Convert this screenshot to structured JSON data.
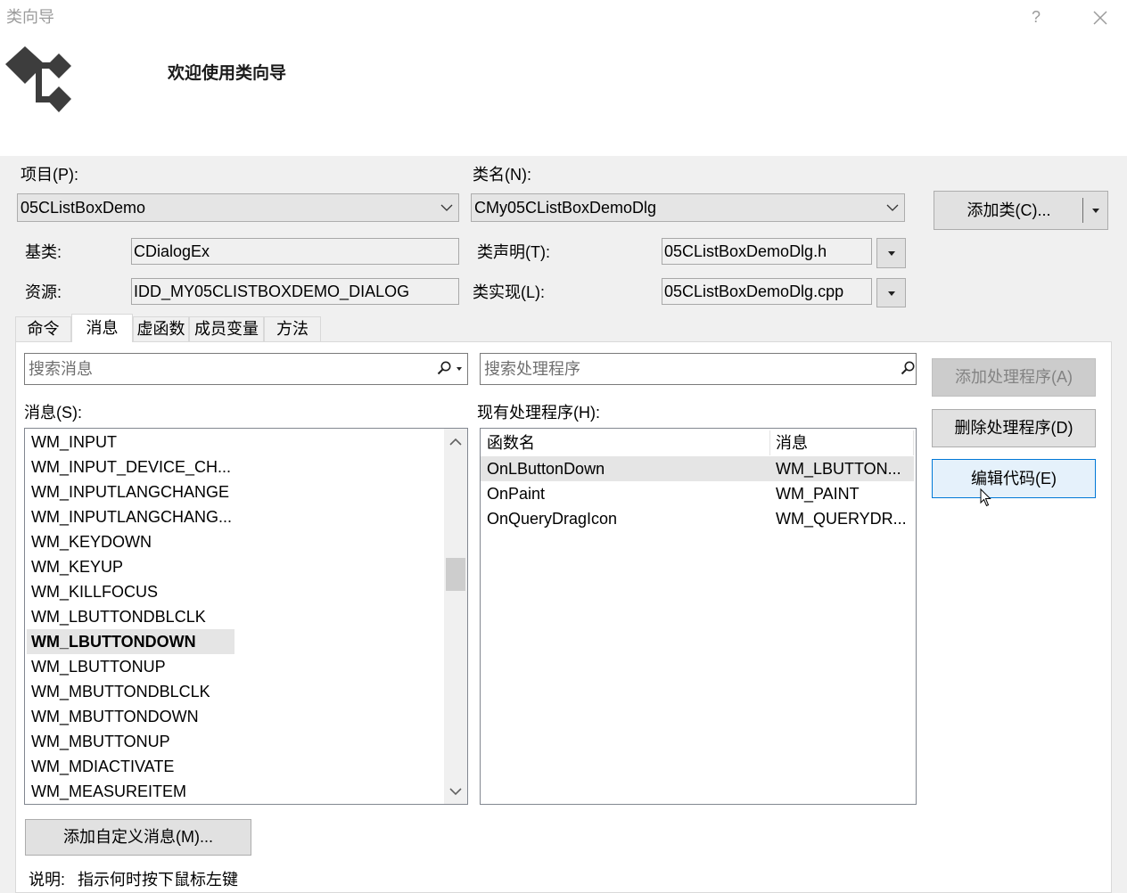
{
  "window": {
    "title": "类向导",
    "help_label": "?"
  },
  "header": {
    "welcome": "欢迎使用类向导"
  },
  "project": {
    "label": "项目(P):",
    "value": "05CListBoxDemo"
  },
  "class_name": {
    "label": "类名(N):",
    "value": "CMy05CListBoxDemoDlg"
  },
  "add_class_button": {
    "label": "添加类(C)..."
  },
  "base_class": {
    "label": "基类:",
    "value": "CDialogEx"
  },
  "class_declaration": {
    "label": "类声明(T):",
    "value": "05CListBoxDemoDlg.h"
  },
  "resource": {
    "label": "资源:",
    "value": "IDD_MY05CLISTBOXDEMO_DIALOG"
  },
  "class_implementation": {
    "label": "类实现(L):",
    "value": "05CListBoxDemoDlg.cpp"
  },
  "tabs": [
    {
      "label": "命令",
      "selected": false
    },
    {
      "label": "消息",
      "selected": true
    },
    {
      "label": "虚函数",
      "selected": false
    },
    {
      "label": "成员变量",
      "selected": false
    },
    {
      "label": "方法",
      "selected": false
    }
  ],
  "messages": {
    "search_placeholder": "搜索消息",
    "label": "消息(S):",
    "items": [
      "WM_INPUT",
      "WM_INPUT_DEVICE_CH...",
      "WM_INPUTLANGCHANGE",
      "WM_INPUTLANGCHANG...",
      "WM_KEYDOWN",
      "WM_KEYUP",
      "WM_KILLFOCUS",
      "WM_LBUTTONDBLCLK",
      "WM_LBUTTONDOWN",
      "WM_LBUTTONUP",
      "WM_MBUTTONDBLCLK",
      "WM_MBUTTONDOWN",
      "WM_MBUTTONUP",
      "WM_MDIACTIVATE",
      "WM_MEASUREITEM"
    ],
    "selected_index": 8
  },
  "handlers": {
    "search_placeholder": "搜索处理程序",
    "label": "现有处理程序(H):",
    "columns": {
      "function": "函数名",
      "message": "消息"
    },
    "rows": [
      {
        "function": "OnLButtonDown",
        "message": "WM_LBUTTON..."
      },
      {
        "function": "OnPaint",
        "message": "WM_PAINT"
      },
      {
        "function": "OnQueryDragIcon",
        "message": "WM_QUERYDR..."
      }
    ],
    "selected_index": 0
  },
  "actions": {
    "add_handler": {
      "label": "添加处理程序(A)",
      "enabled": false
    },
    "delete_handler": {
      "label": "删除处理程序(D)",
      "enabled": true
    },
    "edit_code": {
      "label": "编辑代码(E)",
      "enabled": true,
      "focused": true
    },
    "add_custom_message": {
      "label": "添加自定义消息(M)..."
    }
  },
  "description": {
    "label": "说明:",
    "text": "指示何时按下鼠标左键"
  },
  "icons": {
    "close": "close-icon",
    "logo": "class-wizard-icon",
    "combo": "chevron-down-icon",
    "dropdown": "dropdown-arrow-icon",
    "search": "search-icon",
    "scroll_up": "scroll-up-arrow-icon",
    "scroll_down": "scroll-down-arrow-icon",
    "cursor": "mouse-cursor-icon"
  },
  "colors": {
    "accent": "#0078d7",
    "focused_button_bg": "#e5f1fb",
    "selection_bg": "#e5e5e5",
    "disabled_button_bg": "#cccccc"
  }
}
